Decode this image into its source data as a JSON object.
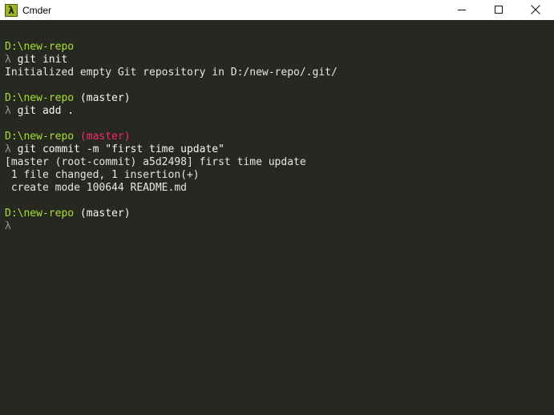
{
  "window": {
    "title": "Cmder",
    "icon": "lambda-icon",
    "icon_glyph": "λ",
    "controls": [
      "minimize",
      "maximize",
      "close"
    ]
  },
  "colors": {
    "background": "#272822",
    "path": "#a6e22e",
    "branch_clean": "#f8f8f2",
    "branch_dirty": "#f92672",
    "prompt_symbol": "#9a9a92"
  },
  "terminal": {
    "lines": [
      {
        "type": "prompt",
        "path": "D:\\new-repo",
        "branch": ""
      },
      {
        "type": "command",
        "symbol": "λ",
        "text": "git init"
      },
      {
        "type": "output",
        "text": "Initialized empty Git repository in D:/new-repo/.git/"
      },
      {
        "type": "blank"
      },
      {
        "type": "prompt",
        "path": "D:\\new-repo",
        "branch": "(master)",
        "dirty": false
      },
      {
        "type": "command",
        "symbol": "λ",
        "text": "git add ."
      },
      {
        "type": "blank"
      },
      {
        "type": "prompt",
        "path": "D:\\new-repo",
        "branch": "(master)",
        "dirty": true
      },
      {
        "type": "command",
        "symbol": "λ",
        "text": "git commit -m \"first time update\""
      },
      {
        "type": "output",
        "text": "[master (root-commit) a5d2498] first time update"
      },
      {
        "type": "output",
        "text": " 1 file changed, 1 insertion(+)"
      },
      {
        "type": "output",
        "text": " create mode 100644 README.md"
      },
      {
        "type": "blank"
      },
      {
        "type": "prompt",
        "path": "D:\\new-repo",
        "branch": "(master)",
        "dirty": false
      },
      {
        "type": "command",
        "symbol": "λ",
        "text": ""
      }
    ]
  }
}
